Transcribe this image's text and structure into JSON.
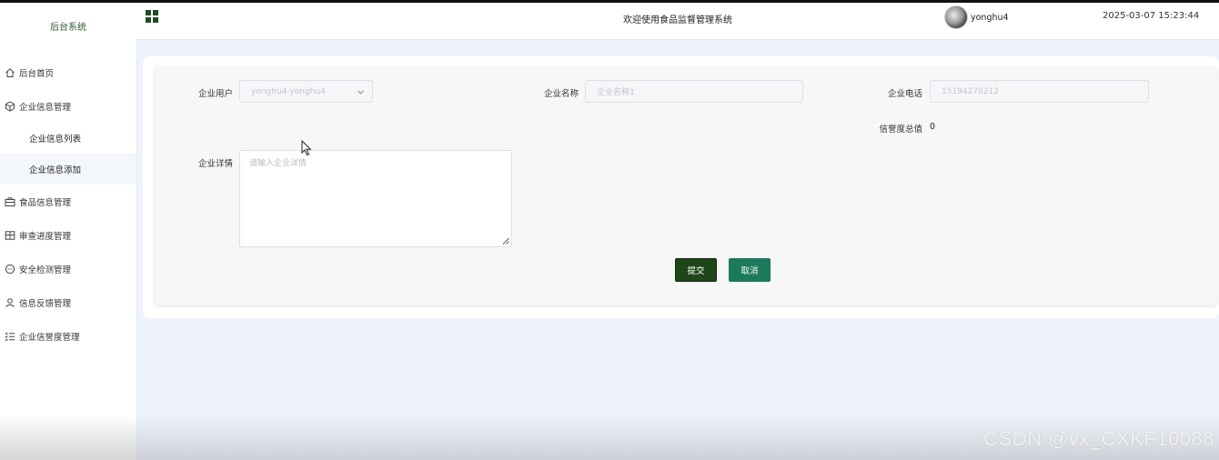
{
  "sidebar": {
    "brand": "后台系统",
    "items": [
      {
        "label": "后台首页",
        "icon": "home-icon"
      },
      {
        "label": "企业信息管理",
        "icon": "cube-icon"
      },
      {
        "label": "食品信息管理",
        "icon": "briefcase-icon"
      },
      {
        "label": "审查进度管理",
        "icon": "layout-icon"
      },
      {
        "label": "安全检测管理",
        "icon": "chat-icon"
      },
      {
        "label": "信息反馈管理",
        "icon": "user-icon"
      },
      {
        "label": "企业信誉度管理",
        "icon": "list-icon"
      }
    ],
    "submenu": [
      {
        "label": "企业信息列表"
      },
      {
        "label": "企业信息添加"
      }
    ]
  },
  "header": {
    "welcome": "欢迎使用食品监督管理系统",
    "username": "yonghu4",
    "datetime": "2025-03-07 15:23:44",
    "accent": "#1f4d1f"
  },
  "form": {
    "user_label": "企业用户",
    "user_value": "yonghu4-yonghu4",
    "name_label": "企业名称",
    "name_placeholder": "企业名称1",
    "phone_label": "企业电话",
    "phone_value": "15194270212",
    "credit_label": "信誉度总值",
    "credit_value": "0",
    "detail_label": "企业详情",
    "detail_placeholder": "请输入企业详情",
    "submit_label": "提交",
    "cancel_label": "取消"
  },
  "watermark": "CSDN @vx_CXKF10088"
}
